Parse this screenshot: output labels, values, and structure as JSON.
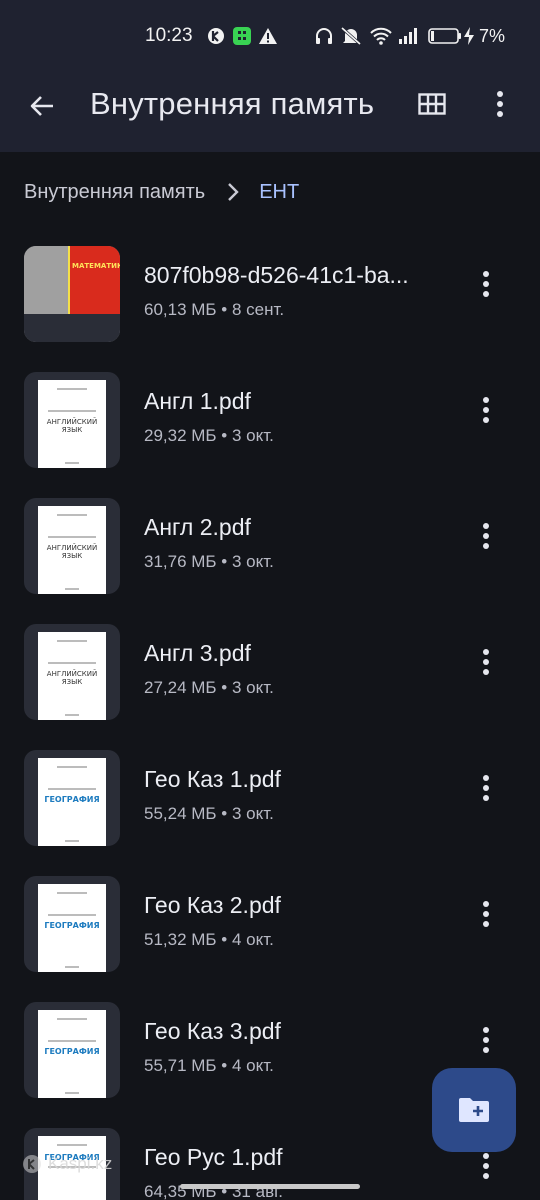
{
  "status_bar": {
    "time": "10:23",
    "battery_percent": "7%",
    "icons": [
      "app-icon",
      "whatsapp-like-icon",
      "warning-icon",
      "headphones-icon",
      "mute-icon",
      "wifi-icon",
      "signal-icon",
      "battery-icon",
      "charging-icon"
    ]
  },
  "app_bar": {
    "title": "Внутренняя память",
    "icons": [
      "back-arrow-icon",
      "grid-view-icon",
      "more-vert-icon"
    ]
  },
  "breadcrumb": {
    "root": "Внутренняя память",
    "current": "ЕНТ"
  },
  "files": [
    {
      "name": "807f0b98-d526-41c1-ba...",
      "meta": "60,13 МБ • 8 сент.",
      "thumb": "math",
      "thumb_text": "МАТЕМАТИКА"
    },
    {
      "name": "Англ 1.pdf",
      "meta": "29,32 МБ • 3 окт.",
      "thumb": "english",
      "thumb_text": "АНГЛИЙСКИЙ ЯЗЫК"
    },
    {
      "name": "Англ 2.pdf",
      "meta": "31,76 МБ • 3 окт.",
      "thumb": "english",
      "thumb_text": "АНГЛИЙСКИЙ ЯЗЫК"
    },
    {
      "name": "Англ 3.pdf",
      "meta": "27,24 МБ • 3 окт.",
      "thumb": "english",
      "thumb_text": "АНГЛИЙСКИЙ ЯЗЫК"
    },
    {
      "name": "Гео Каз 1.pdf",
      "meta": "55,24 МБ • 3 окт.",
      "thumb": "geo",
      "thumb_text": "ГЕОГРАФИЯ"
    },
    {
      "name": "Гео Каз 2.pdf",
      "meta": "51,32 МБ • 4 окт.",
      "thumb": "geo",
      "thumb_text": "ГЕОГРАФИЯ"
    },
    {
      "name": "Гео Каз 3.pdf",
      "meta": "55,71 МБ • 4 окт.",
      "thumb": "geo",
      "thumb_text": "ГЕОГРАФИЯ"
    },
    {
      "name": "Гео Рус 1.pdf",
      "meta": "64,35 МБ • 31 авг.",
      "thumb": "geo",
      "thumb_text": "ГЕОГРАФИЯ"
    }
  ],
  "fab": {
    "icon": "new-folder-icon"
  },
  "watermark": {
    "text": "Kaspi.kz"
  },
  "colors": {
    "background": "#121419",
    "app_bar": "#1f2230",
    "accent": "#a9c2ff",
    "fab": "#2d4a8a"
  }
}
